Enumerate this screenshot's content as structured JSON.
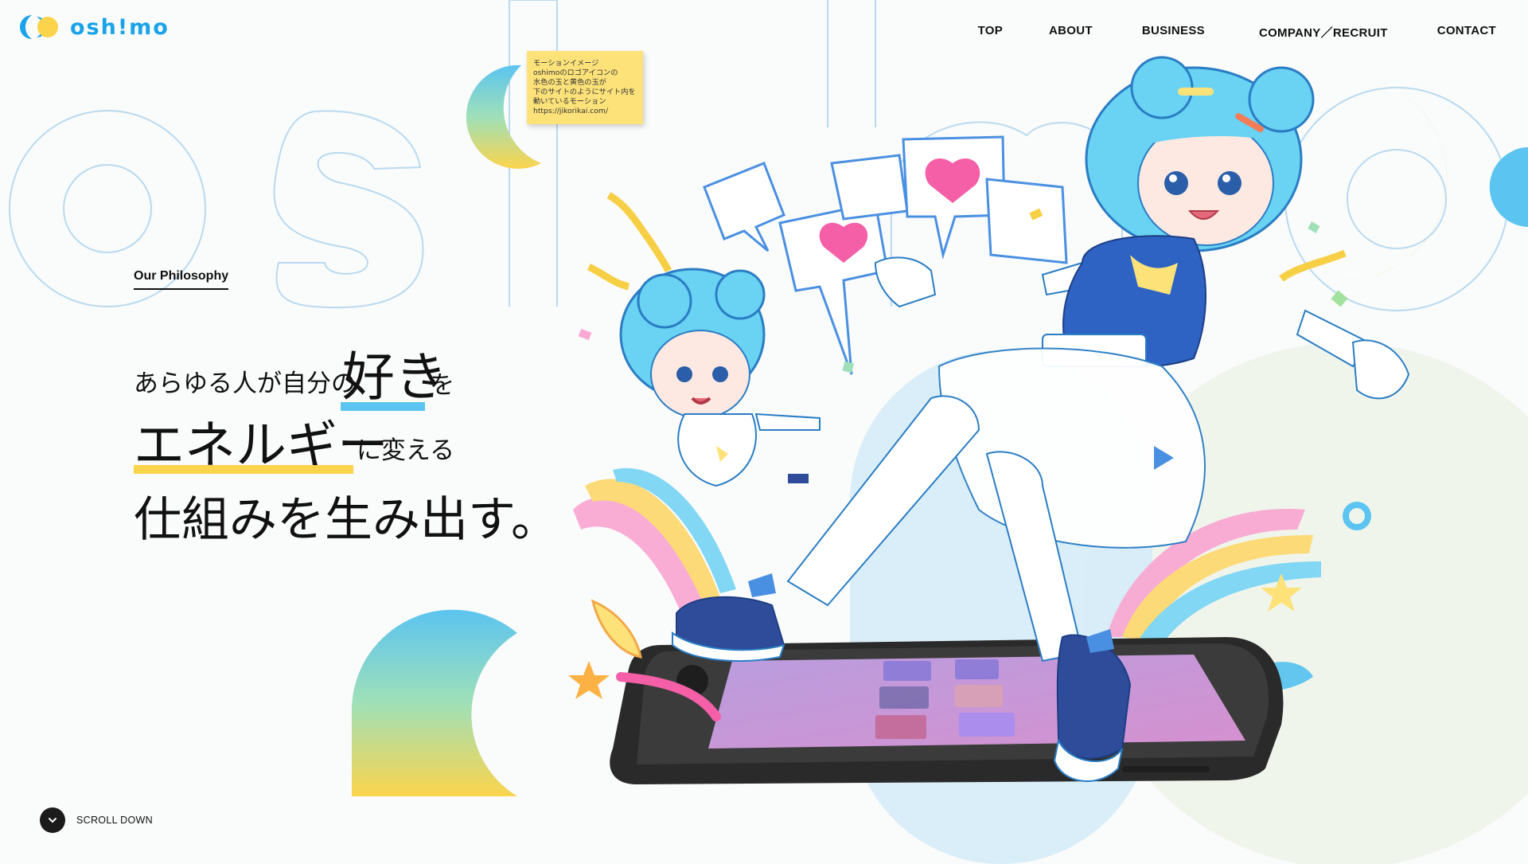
{
  "brand": {
    "name": "osh!mo",
    "color_blue": "#1aa3e8",
    "color_yellow": "#fbd44c"
  },
  "nav": {
    "items": [
      {
        "label": "TOP"
      },
      {
        "label": "ABOUT"
      },
      {
        "label": "BUSINESS"
      },
      {
        "label": "COMPANY／RECRUIT"
      },
      {
        "label": "CONTACT"
      }
    ]
  },
  "hero": {
    "section_label": "Our Philosophy",
    "line1_pre": "あらゆる人が自分の",
    "line1_big": "好き",
    "line1_post": "を",
    "line2_big": "エネルギー",
    "line2_post": "に変える",
    "line3": "仕組みを生み出す。",
    "background_word": "oshimo"
  },
  "note": {
    "lines": [
      "モーションイメージ",
      "oshimoのロゴアイコンの",
      "水色の玉と黄色の玉が",
      "下のサイトのようにサイト内を",
      "動いているモーション",
      "https://jikorikai.com/"
    ]
  },
  "scroll": {
    "label": "SCROLL DOWN"
  },
  "illustration": {
    "subject": "anime-girl-on-smartphone",
    "icon": "heart-icon"
  }
}
